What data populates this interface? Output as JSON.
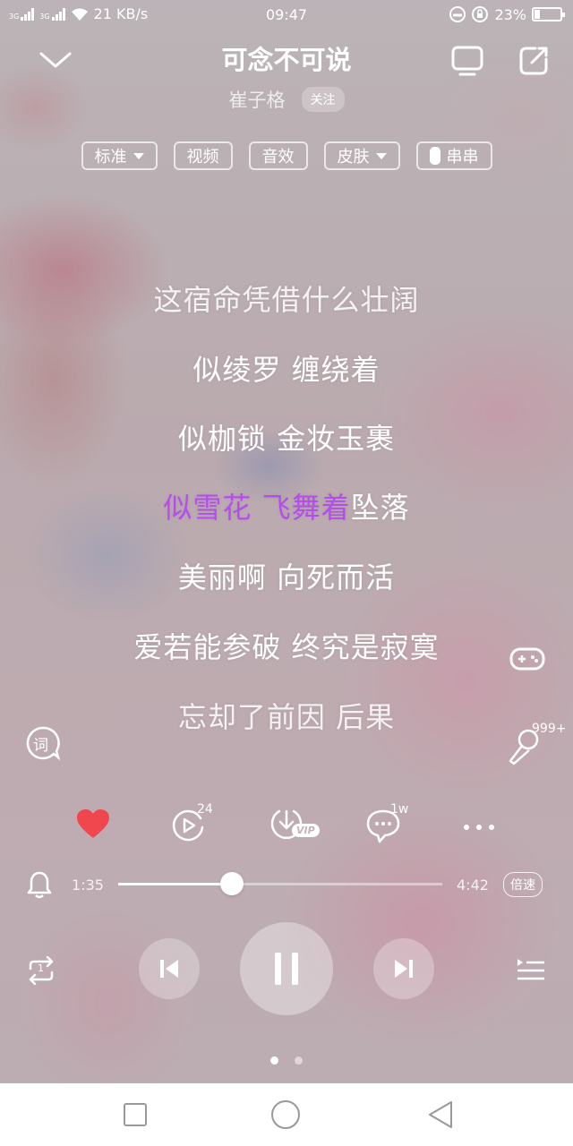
{
  "status_bar": {
    "signal1_label": "3G",
    "signal2_label": "3G",
    "net_speed": "21 KB/s",
    "time": "09:47",
    "battery_text": "23%",
    "battery_level": 0.23
  },
  "header": {
    "title": "可念不可说",
    "artist": "崔子格",
    "follow_label": "关注"
  },
  "chips": [
    {
      "label": "标准",
      "has_dropdown": true
    },
    {
      "label": "视频",
      "has_dropdown": false
    },
    {
      "label": "音效",
      "has_dropdown": false
    },
    {
      "label": "皮肤",
      "has_dropdown": true
    },
    {
      "label": "串串",
      "has_toggle": true
    }
  ],
  "lyrics": {
    "line1": "这宿命凭借什么壮阔",
    "line2": "似绫罗  缠绕着",
    "line3": "似枷锁  金妆玉裹",
    "line4_sung": "似雪花  飞舞着",
    "line4_rest": "坠落",
    "line5": "美丽啊  向死而活",
    "line6": "爱若能参破  终究是寂寞",
    "line7": "忘却了前因  后果"
  },
  "side": {
    "lyric_button_label": "词",
    "singing_count": "999+"
  },
  "actions": {
    "like_color": "#f0474f",
    "video_count": "24",
    "download_badge": "VIP",
    "comment_count": "1w"
  },
  "progress": {
    "current": "1:35",
    "total": "4:42",
    "fraction": 0.35,
    "speed_label": "倍速"
  },
  "controls": {
    "repeat_badge": "1"
  },
  "pager": {
    "count": 2,
    "active": 0
  },
  "accent_color": "#b44cf0"
}
